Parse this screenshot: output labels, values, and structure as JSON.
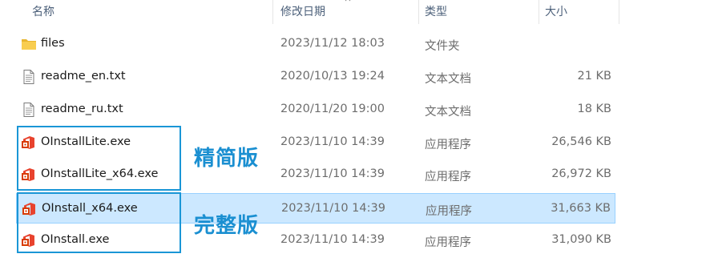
{
  "columns": {
    "name": "名称",
    "date": "修改日期",
    "type": "类型",
    "size": "大小"
  },
  "files": [
    {
      "name": "files",
      "date": "2023/11/12 18:03",
      "type": "文件夹",
      "size": "",
      "icon": "folder-icon"
    },
    {
      "name": "readme_en.txt",
      "date": "2020/10/13 19:24",
      "type": "文本文档",
      "size": "21 KB",
      "icon": "text-file-icon"
    },
    {
      "name": "readme_ru.txt",
      "date": "2020/11/20 19:00",
      "type": "文本文档",
      "size": "18 KB",
      "icon": "text-file-icon"
    },
    {
      "name": "OInstallLite.exe",
      "date": "2023/11/10 14:39",
      "type": "应用程序",
      "size": "26,546 KB",
      "icon": "office-app-icon"
    },
    {
      "name": "OInstallLite_x64.exe",
      "date": "2023/11/10 14:39",
      "type": "应用程序",
      "size": "26,972 KB",
      "icon": "office-app-icon"
    },
    {
      "name": "OInstall_x64.exe",
      "date": "2023/11/10 14:39",
      "type": "应用程序",
      "size": "31,663 KB",
      "icon": "office-app-icon",
      "selected": true
    },
    {
      "name": "OInstall.exe",
      "date": "2023/11/10 14:39",
      "type": "应用程序",
      "size": "31,090 KB",
      "icon": "office-app-icon"
    }
  ],
  "annotations": {
    "lite_label": "精简版",
    "full_label": "完整版",
    "box_color": "#1a96d6"
  },
  "colors": {
    "selection_bg": "#cce8ff",
    "folder": "#f5c542",
    "office_red": "#e8432e"
  }
}
